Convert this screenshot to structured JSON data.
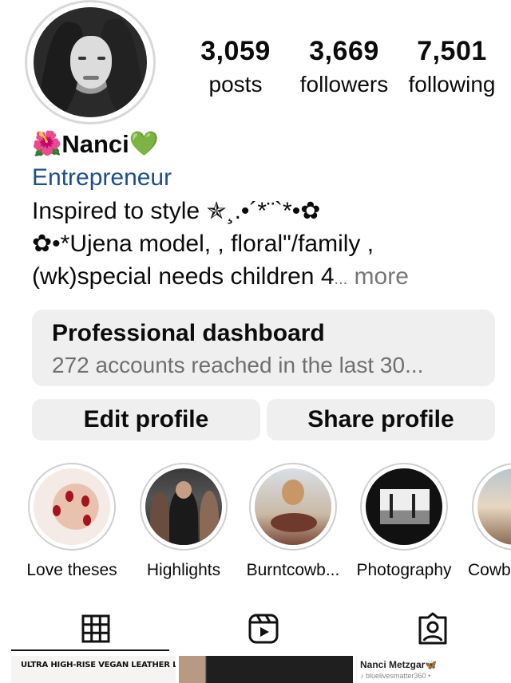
{
  "profile": {
    "stats": {
      "posts_count": "3,059",
      "posts_label": "posts",
      "followers_count": "3,669",
      "followers_label": "followers",
      "following_count": "7,501",
      "following_label": "following"
    },
    "name_prefix_emoji": "🌺",
    "name": "Nanci",
    "name_suffix_emoji": "💚",
    "category": "Entrepreneur",
    "bio_lines": [
      "Inspired to style ✯¸.•´*¨`*•✿",
      "✿•*Ujena model, , floral\"/family ,",
      "(wk)special needs children 4"
    ],
    "bio_ellipsis": "...",
    "bio_more": "more"
  },
  "dashboard": {
    "title": "Professional dashboard",
    "subtitle": "272 accounts reached in the last 30..."
  },
  "actions": {
    "edit_label": "Edit profile",
    "share_label": "Share profile"
  },
  "highlights": [
    {
      "label": "Love theses"
    },
    {
      "label": "Highlights"
    },
    {
      "label": "Burntcowb..."
    },
    {
      "label": "Photography"
    },
    {
      "label": "Cowb"
    }
  ],
  "tabs": [
    {
      "icon": "grid-icon",
      "selected": true
    },
    {
      "icon": "reels-icon",
      "selected": false
    },
    {
      "icon": "tagged-icon",
      "selected": false
    }
  ],
  "posts": {
    "post_1_text": "ULTRA HIGH-RISE VEGAN LEATHER LEGGINGS",
    "post_3_name": "Nanci Metzgar🦋",
    "post_3_sub": "♪ bluelivesmatter360 •"
  },
  "colors": {
    "category_link": "#1b4f8a",
    "button_bg": "#efefef",
    "muted_text": "#6f6f6f"
  }
}
